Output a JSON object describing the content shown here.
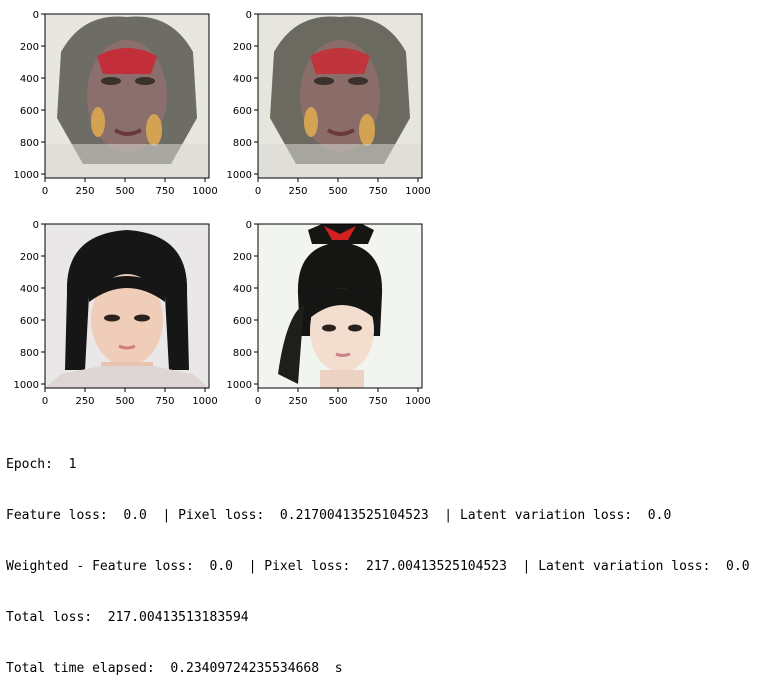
{
  "plots": [
    {
      "image": "reconstructed-face-a",
      "yticks": [
        "0",
        "200",
        "400",
        "600",
        "800",
        "1000"
      ],
      "xticks": [
        "0",
        "250",
        "500",
        "750",
        "1000"
      ],
      "colors": {
        "bg": "#e8e6e1",
        "hair": "#6d6d66",
        "skin": "#8b6f6d",
        "patch": "#c22f3b"
      }
    },
    {
      "image": "reconstructed-face-b",
      "yticks": [
        "0",
        "200",
        "400",
        "600",
        "800",
        "1000"
      ],
      "xticks": [
        "0",
        "250",
        "500",
        "750",
        "1000"
      ],
      "colors": {
        "bg": "#e6e6df",
        "hair": "#6a6a61",
        "skin": "#8a6d69",
        "patch": "#c0343c"
      }
    },
    {
      "image": "source-face-bob-hair",
      "yticks": [
        "0",
        "200",
        "400",
        "600",
        "800",
        "1000"
      ],
      "xticks": [
        "0",
        "250",
        "500",
        "750",
        "1000"
      ],
      "colors": {
        "bg": "#e9e7e7",
        "hair": "#161616",
        "skin": "#efcdb9",
        "patch": "#d57d80"
      }
    },
    {
      "image": "target-face-ponytail",
      "yticks": [
        "0",
        "200",
        "400",
        "600",
        "800",
        "1000"
      ],
      "xticks": [
        "0",
        "250",
        "500",
        "750",
        "1000"
      ],
      "colors": {
        "bg": "#f1f4ef",
        "hair": "#151514",
        "skin": "#f2ddcf",
        "patch": "#d32020"
      }
    }
  ],
  "console": {
    "epoch": "Epoch:  1",
    "loss": "Feature loss:  0.0  | Pixel loss:  0.21700413525104523  | Latent variation loss:  0.0",
    "weighted": "Weighted - Feature loss:  0.0  | Pixel loss:  217.00413525104523  | Latent variation loss:  0.0",
    "total": "Total loss:  217.00413513183594",
    "time": "Total time elapsed:  0.23409724235534668  s"
  }
}
